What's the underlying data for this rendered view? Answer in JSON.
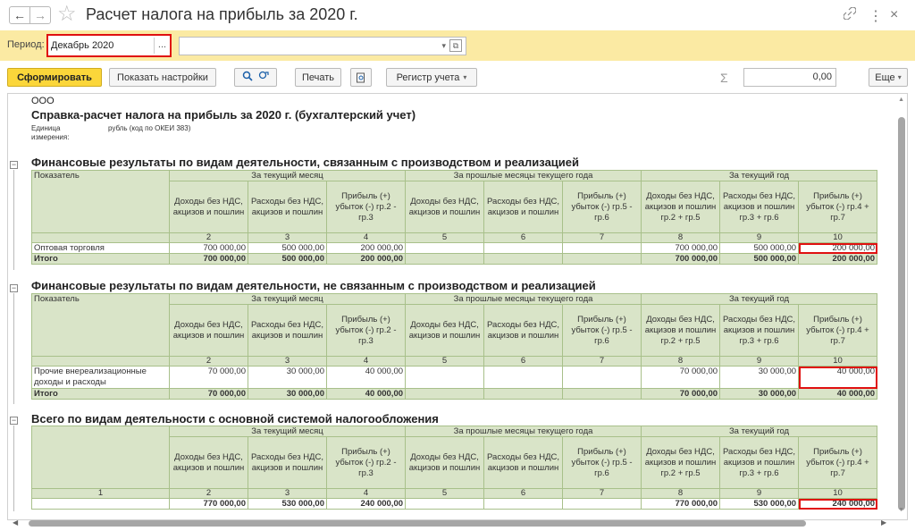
{
  "window": {
    "title": "Расчет налога на прибыль за 2020 г.",
    "back_glyph": "←",
    "forward_glyph": "→",
    "link_glyph": "🔗",
    "more_glyph": "⋮",
    "close_glyph": "×"
  },
  "period_bar": {
    "label": "Период:",
    "value": "Декабрь 2020",
    "dots": "...",
    "org_value": "",
    "drop_glyph": "▾",
    "open_glyph": "⧉"
  },
  "toolbar": {
    "generate": "Сформировать",
    "show_settings": "Показать настройки",
    "find_glyph": "🔍",
    "find_next_glyph": "↷",
    "print": "Печать",
    "preview_glyph": "🔎",
    "register": "Регистр учета",
    "sigma": "Σ",
    "sum_value": "0,00",
    "more": "Еще"
  },
  "report": {
    "org": "ООО",
    "title": "Справка-расчет налога на прибыль за 2020 г. (бухгалтерский учет)",
    "unit_label": "Единица измерения:",
    "unit_value": "рубль (код по ОКЕИ 383)",
    "headers": {
      "indicator": "Показатель",
      "current_month": "За текущий месяц",
      "prev_months": "За прошлые месяцы текущего года",
      "current_year": "За текущий год",
      "income": "Доходы без НДС, акцизов и пошлин",
      "expenses": "Расходы без НДС, акцизов и пошлин",
      "profit_m": "Прибыль (+) убыток (-) гр.2 - гр.3",
      "income_p": "Доходы без НДС, акцизов и пошлин",
      "expenses_p": "Расходы без НДС, акцизов и пошлин",
      "profit_p": "Прибыль (+) убыток (-) гр.5 - гр.6",
      "income_y": "Доходы без НДС, акцизов и пошлин гр.2 + гр.5",
      "expenses_y": "Расходы без НДС, акцизов и пошлин гр.3 + гр.6",
      "profit_y": "Прибыль (+) убыток (-) гр.4 + гр.7",
      "col_numbers": [
        "2",
        "3",
        "4",
        "5",
        "6",
        "7",
        "8",
        "9",
        "10"
      ],
      "first_col_number": "1"
    },
    "sections": [
      {
        "title": "Финансовые результаты по видам деятельности, связанным с производством и реализацией",
        "rows": [
          {
            "label": "Оптовая торговля",
            "values": [
              "700 000,00",
              "500 000,00",
              "200 000,00",
              "",
              "",
              "",
              "700 000,00",
              "500 000,00",
              "200 000,00"
            ]
          }
        ],
        "total": {
          "label": "Итого",
          "values": [
            "700 000,00",
            "500 000,00",
            "200 000,00",
            "",
            "",
            "",
            "700 000,00",
            "500 000,00",
            "200 000,00"
          ]
        }
      },
      {
        "title": "Финансовые результаты по видам деятельности, не связанным с производством и реализацией",
        "rows": [
          {
            "label": "Прочие внереализационные доходы и расходы",
            "values": [
              "70 000,00",
              "30 000,00",
              "40 000,00",
              "",
              "",
              "",
              "70 000,00",
              "30 000,00",
              "40 000,00"
            ]
          }
        ],
        "total": {
          "label": "Итого",
          "values": [
            "70 000,00",
            "30 000,00",
            "40 000,00",
            "",
            "",
            "",
            "70 000,00",
            "30 000,00",
            "40 000,00"
          ]
        }
      },
      {
        "title": "Всего по видам деятельности с основной системой налогообложения",
        "total": {
          "label": "",
          "values": [
            "770 000,00",
            "530 000,00",
            "240 000,00",
            "",
            "",
            "",
            "770 000,00",
            "530 000,00",
            "240 000,00"
          ]
        }
      }
    ]
  }
}
